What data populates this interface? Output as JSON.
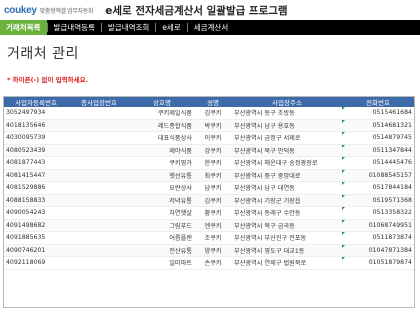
{
  "header": {
    "logo_text": "coukey",
    "logo_sub": "맞춤형엑셀 업무자동화",
    "app_title": "e세로 전자세금계산서 일괄발급 프로그램"
  },
  "nav": {
    "tabs": [
      {
        "label": "거래처목록",
        "active": true
      },
      {
        "label": "발급내역등록",
        "active": false
      },
      {
        "label": "발급내역조회",
        "active": false
      },
      {
        "label": "e세로",
        "active": false
      },
      {
        "label": "세금계산서",
        "active": false
      }
    ]
  },
  "page_title": "거래처 관리",
  "note": "* 하이픈(-) 없이 입력하세요.",
  "table": {
    "columns": [
      "사업자등록번호",
      "종사업장번호",
      "상호명",
      "성명",
      "사업장주소",
      "전화번호"
    ],
    "rows": [
      [
        "3052497934",
        "",
        "쿠키제일식품",
        "김쿠키",
        "부산광역시 동구 조방동",
        "0515461684"
      ],
      [
        "4018135646",
        "",
        "레드종합식품",
        "박쿠키",
        "부산광역시 남구 용호동",
        "0514681321"
      ],
      [
        "4030095739",
        "",
        "대표식품상사",
        "이쿠키",
        "부산광역시 금정구 서제로",
        "0514879745"
      ],
      [
        "4080523439",
        "",
        "제야식품",
        "강쿠키",
        "부산광역시 북구 만덕동",
        "0511347844"
      ],
      [
        "4081877443",
        "",
        "쿠키영가",
        "한쿠키",
        "부산광역시 해운대구 송정광장로",
        "0514445476"
      ],
      [
        "4081415447",
        "",
        "햇선유통",
        "최쿠키",
        "부산광역시 중구 중앙대로",
        "01088545157"
      ],
      [
        "4081529886",
        "",
        "요란상사",
        "남쿠키",
        "부산광역시 남구 대연동",
        "0517844184"
      ],
      [
        "4088158833",
        "",
        "저녁유통",
        "김쿠키",
        "부산광역시 기장군 기장읍",
        "0519571368"
      ],
      [
        "4090054243",
        "",
        "자연햇살",
        "황쿠키",
        "부산광역시 동래구 수안동",
        "0513358322"
      ],
      [
        "4091498682",
        "",
        "그림푸드",
        "엔쿠키",
        "부산광역시 북구 금곡동",
        "01068749951"
      ],
      [
        "4091885635",
        "",
        "어름플랜",
        "조쿠키",
        "부산광역시 부산진구 전포동",
        "0511873874"
      ],
      [
        "4090746201",
        "",
        "전산유통",
        "양쿠키",
        "부산광역시 영도구 대교1동",
        "01047871384"
      ],
      [
        "4092118069",
        "",
        "일미마트",
        "손쿠키",
        "부산광역시 연제구 법원북로",
        "01051879874"
      ]
    ]
  },
  "colors": {
    "nav_bg": "#000000",
    "nav_active": "#6bb23c",
    "header_bg": "#3d6aa8",
    "note_red": "#e02020"
  }
}
